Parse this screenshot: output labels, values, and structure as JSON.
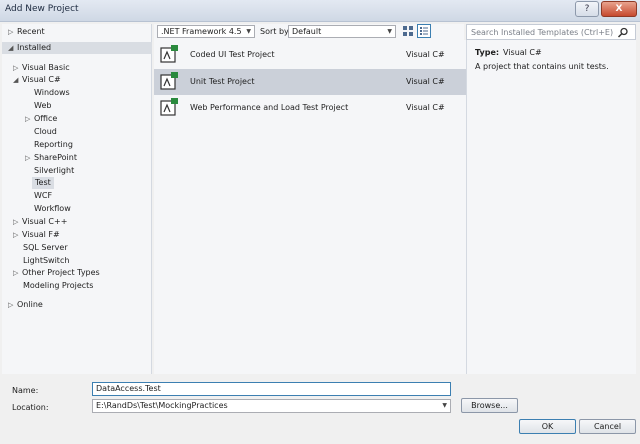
{
  "window": {
    "title": "Add New Project",
    "help_label": "?",
    "close_label": "X"
  },
  "sidebar": {
    "items": [
      {
        "label": "Recent",
        "arrow": "▷"
      },
      {
        "label": "Installed",
        "arrow": "◢"
      },
      {
        "label": "Visual Basic",
        "arrow": "▷"
      },
      {
        "label": "Visual C#",
        "arrow": "◢"
      },
      {
        "label": "Windows",
        "arrow": ""
      },
      {
        "label": "Web",
        "arrow": ""
      },
      {
        "label": "Office",
        "arrow": "▷"
      },
      {
        "label": "Cloud",
        "arrow": ""
      },
      {
        "label": "Reporting",
        "arrow": ""
      },
      {
        "label": "SharePoint",
        "arrow": "▷"
      },
      {
        "label": "Silverlight",
        "arrow": ""
      },
      {
        "label": "Test",
        "arrow": ""
      },
      {
        "label": "WCF",
        "arrow": ""
      },
      {
        "label": "Workflow",
        "arrow": ""
      },
      {
        "label": "Visual C++",
        "arrow": "▷"
      },
      {
        "label": "Visual F#",
        "arrow": "▷"
      },
      {
        "label": "SQL Server",
        "arrow": ""
      },
      {
        "label": "LightSwitch",
        "arrow": ""
      },
      {
        "label": "Other Project Types",
        "arrow": "▷"
      },
      {
        "label": "Modeling Projects",
        "arrow": ""
      },
      {
        "label": "Online",
        "arrow": "▷"
      }
    ]
  },
  "toolbar": {
    "framework": ".NET Framework 4.5",
    "sort_label": "Sort by:",
    "sort_value": "Default"
  },
  "templates": [
    {
      "name": "Coded UI Test Project",
      "lang": "Visual C#"
    },
    {
      "name": "Unit Test Project",
      "lang": "Visual C#"
    },
    {
      "name": "Web Performance and Load Test Project",
      "lang": "Visual C#"
    }
  ],
  "details": {
    "search_placeholder": "Search Installed Templates (Ctrl+E)",
    "type_label": "Type:",
    "type_value": "Visual C#",
    "description": "A project that contains unit tests."
  },
  "form": {
    "name_label": "Name:",
    "name_value": "DataAccess.Test",
    "location_label": "Location:",
    "location_value": "E:\\RandDs\\Test\\MockingPractices",
    "browse_label": "Browse...",
    "ok_label": "OK",
    "cancel_label": "Cancel"
  },
  "colors": {
    "selection": "#cbd0d9",
    "accent": "#3c7fb1"
  }
}
